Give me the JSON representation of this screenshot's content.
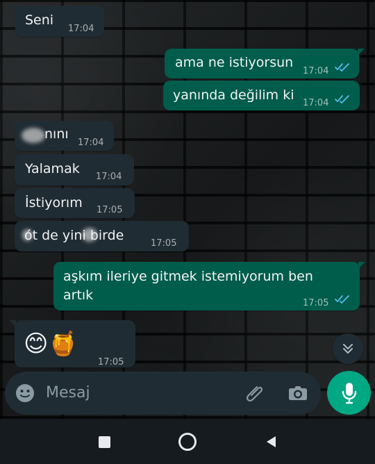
{
  "messages": [
    {
      "text": "Seni",
      "time": "17:04"
    },
    {
      "text": "ama ne istiyorsun",
      "time": "17:04"
    },
    {
      "text": "yanında değilim ki",
      "time": "17:04"
    },
    {
      "text": "nını",
      "time": "17:04"
    },
    {
      "text": "Yalamak",
      "time": "17:04"
    },
    {
      "text": "İstiyorım",
      "time": "17:05"
    },
    {
      "text": "ót de yini birde",
      "time": "17:05"
    },
    {
      "text_line1": "aşkım ileriye gitmek istemiyorum ben",
      "text_line2": "artık",
      "time": "17:05"
    },
    {
      "emoji": "😊🍯",
      "time": "17:05"
    }
  ],
  "composer": {
    "placeholder": "Mesaj"
  },
  "icons": {
    "read_ticks": "double-check-icon",
    "emoji": "emoji-icon",
    "attach": "paperclip-icon",
    "camera": "camera-icon",
    "mic": "mic-icon",
    "scroll_down": "chevron-double-down-icon",
    "nav_recents": "square-icon",
    "nav_home": "circle-icon",
    "nav_back": "triangle-icon"
  },
  "colors": {
    "incoming_bubble": "#202c33",
    "outgoing_bubble": "#005c4b",
    "read_ticks": "#53bdeb",
    "mic_button": "#00a884"
  }
}
